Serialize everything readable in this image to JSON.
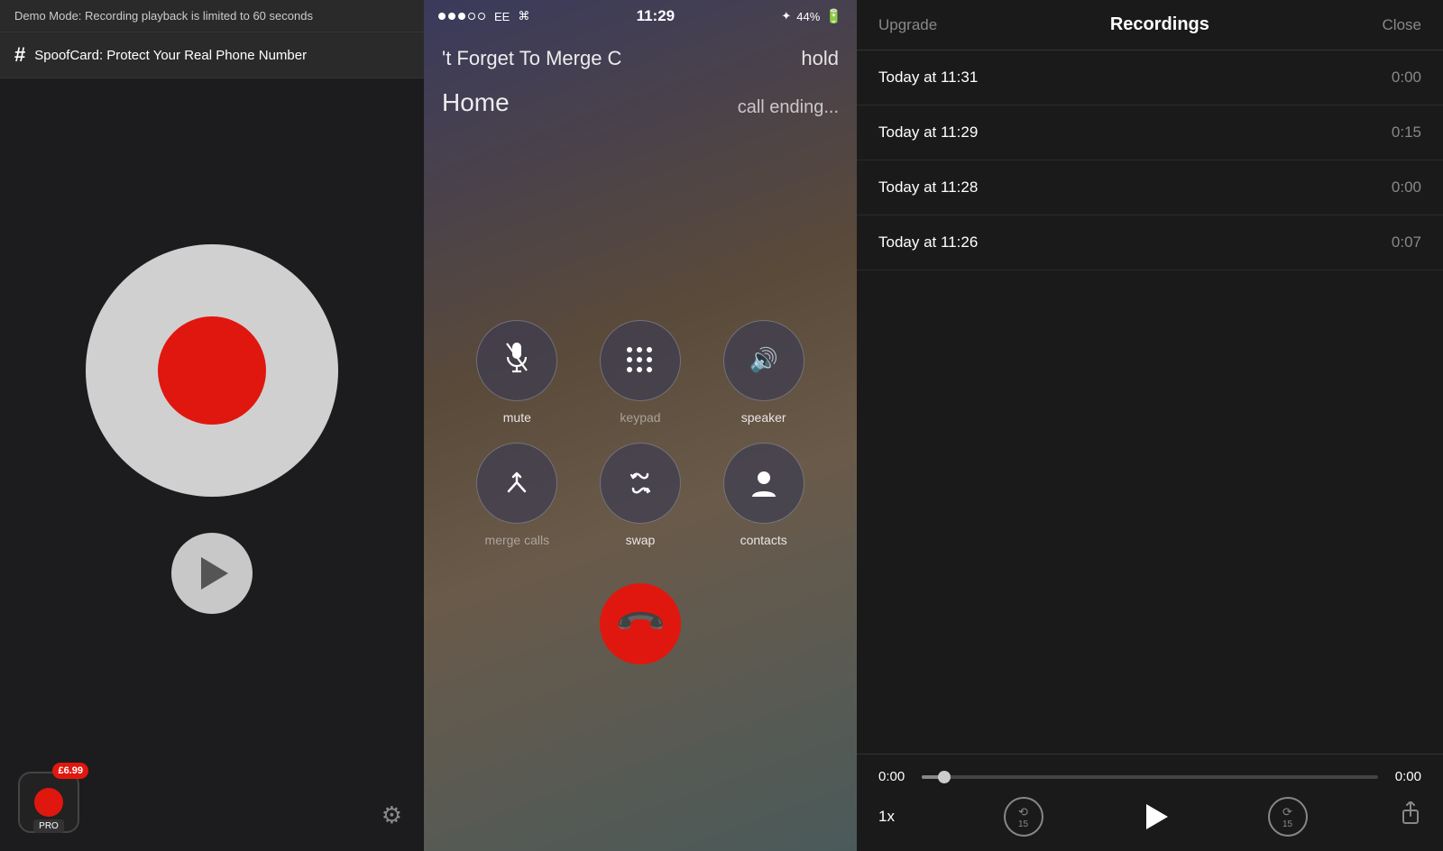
{
  "left": {
    "demo_banner": "Demo Mode: Recording playback is limited to 60 seconds",
    "spoofcard_label": "SpoofCard: Protect Your Real Phone Number",
    "price": "£6.99",
    "pro_label": "PRO"
  },
  "phone": {
    "dots": [
      "filled",
      "filled",
      "filled",
      "empty",
      "empty"
    ],
    "carrier": "EE",
    "time": "11:29",
    "battery": "44%",
    "call_label": "'t Forget To Merge C",
    "hold_label": "hold",
    "home_label": "Home",
    "call_ending": "call ending...",
    "buttons": [
      {
        "id": "mute",
        "label": "mute",
        "dim": false
      },
      {
        "id": "keypad",
        "label": "keypad",
        "dim": true
      },
      {
        "id": "speaker",
        "label": "speaker",
        "dim": false
      },
      {
        "id": "merge-calls",
        "label": "merge calls",
        "dim": true
      },
      {
        "id": "swap",
        "label": "swap",
        "dim": false
      },
      {
        "id": "contacts",
        "label": "contacts",
        "dim": false
      }
    ]
  },
  "recordings": {
    "title": "Recordings",
    "upgrade_label": "Upgrade",
    "close_label": "Close",
    "items": [
      {
        "time": "Today at 11:31",
        "duration": "0:00"
      },
      {
        "time": "Today at 11:29",
        "duration": "0:15"
      },
      {
        "time": "Today at 11:28",
        "duration": "0:00"
      },
      {
        "time": "Today at 11:26",
        "duration": "0:07"
      }
    ],
    "player": {
      "time_start": "0:00",
      "time_end": "0:00",
      "speed": "1x",
      "rewind_label": "15",
      "forward_label": "15"
    }
  }
}
